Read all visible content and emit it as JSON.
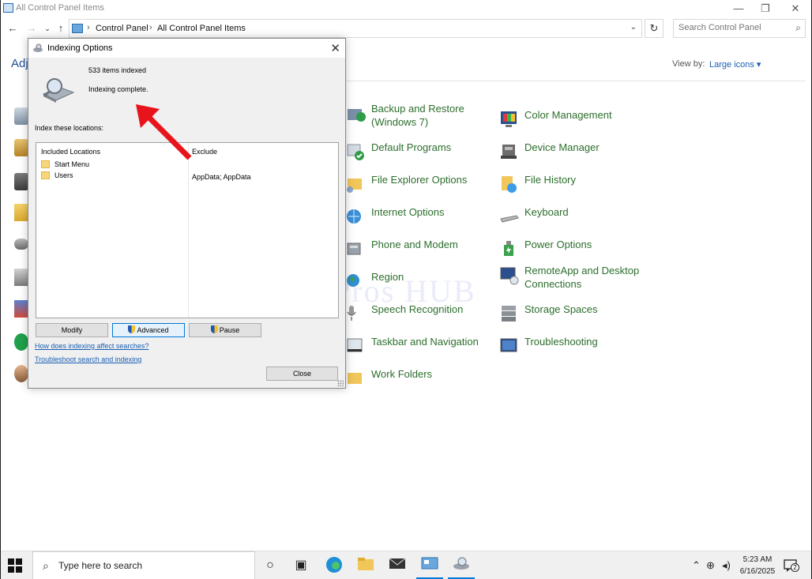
{
  "window": {
    "title": "All Control Panel Items",
    "minimize": "—",
    "maximize": "❐",
    "close": "✕"
  },
  "address": {
    "crumbs": [
      "Control Panel",
      "All Control Panel Items"
    ],
    "search_placeholder": "Search Control Panel"
  },
  "content": {
    "heading_partial": "Adj",
    "view_by_label": "View by:",
    "view_by_value": "Large icons ▾",
    "watermark": "IT Pros HUB"
  },
  "items": [
    {
      "label": "Backup and Restore (Windows 7)",
      "icon": "backup-icon"
    },
    {
      "label": "Color Management",
      "icon": "color-management-icon"
    },
    {
      "label": "Default Programs",
      "icon": "default-programs-icon"
    },
    {
      "label": "Device Manager",
      "icon": "device-manager-icon"
    },
    {
      "label": "File Explorer Options",
      "icon": "file-explorer-options-icon"
    },
    {
      "label": "File History",
      "icon": "file-history-icon"
    },
    {
      "label": "Internet Options",
      "icon": "internet-options-icon"
    },
    {
      "label": "Keyboard",
      "icon": "keyboard-icon"
    },
    {
      "label": "Phone and Modem",
      "icon": "phone-modem-icon"
    },
    {
      "label": "Power Options",
      "icon": "power-options-icon"
    },
    {
      "label": "Region",
      "icon": "region-icon"
    },
    {
      "label": "RemoteApp and Desktop Connections",
      "icon": "remoteapp-icon"
    },
    {
      "label": "Speech Recognition",
      "icon": "speech-recognition-icon"
    },
    {
      "label": "Storage Spaces",
      "icon": "storage-spaces-icon"
    },
    {
      "label": "Taskbar and Navigation",
      "icon": "taskbar-navigation-icon"
    },
    {
      "label": "Troubleshooting",
      "icon": "troubleshooting-icon"
    },
    {
      "label": "Work Folders",
      "icon": "work-folders-icon"
    }
  ],
  "dialog": {
    "title": "Indexing Options",
    "close": "✕",
    "count": "533 items indexed",
    "status": "Indexing complete.",
    "locations_label": "Index these locations:",
    "col_included": "Included Locations",
    "col_exclude": "Exclude",
    "locations": [
      {
        "name": "Start Menu",
        "exclude": ""
      },
      {
        "name": "Users",
        "exclude": "AppData; AppData"
      }
    ],
    "buttons": {
      "modify": "Modify",
      "advanced": "Advanced",
      "pause": "Pause",
      "close": "Close"
    },
    "links": {
      "how": "How does indexing affect searches?",
      "troubleshoot": "Troubleshoot search and indexing"
    }
  },
  "taskbar": {
    "search_placeholder": "Type here to search",
    "time": "5:23 AM",
    "date": "6/16/2025",
    "notifications": "2"
  },
  "colors": {
    "accent": "#0078d7",
    "link": "#1a5fb4",
    "item_text": "#2c6e2c",
    "arrow": "#e8141b"
  }
}
